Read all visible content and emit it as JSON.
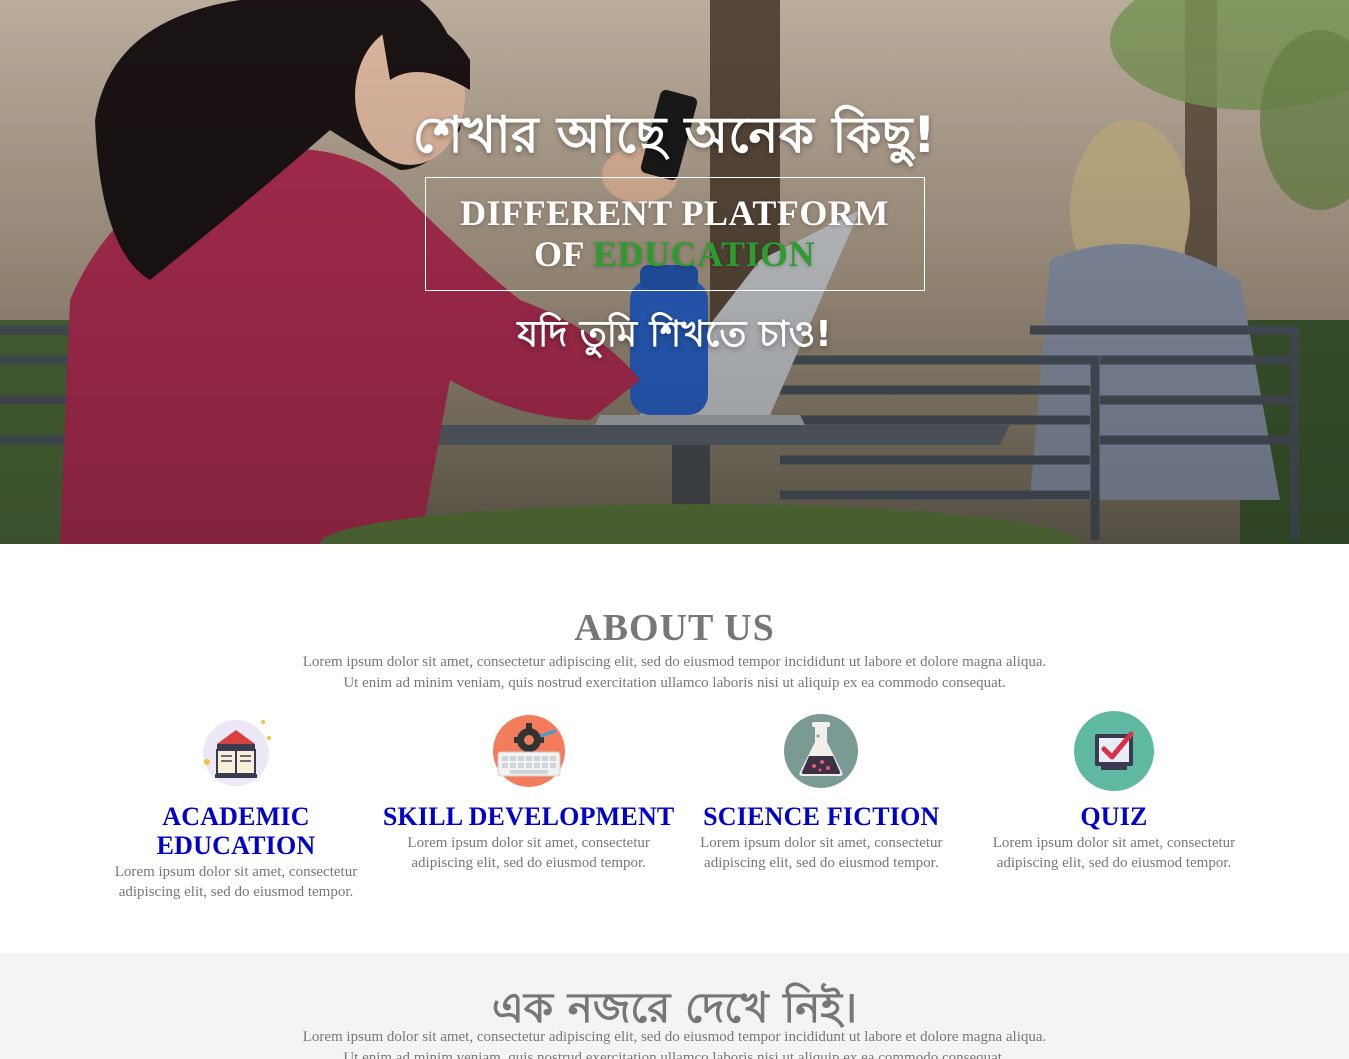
{
  "hero": {
    "title": "শেখার আছে অনেক কিছু!",
    "box_line1": "DIFFERENT PLATFORM",
    "box_line2_prefix": "OF ",
    "box_line2_accent": "EDUCATION",
    "subtitle": "যদি তুমি শিখতে চাও!",
    "accent_color": "#2e9b2e"
  },
  "about": {
    "title": "ABOUT US",
    "desc_line1": "Lorem ipsum dolor sit amet, consectetur adipiscing elit, sed do eiusmod tempor incididunt ut labore et dolore magna aliqua.",
    "desc_line2": "Ut enim ad minim veniam, quis nostrud exercitation ullamco laboris nisi ut aliquip ex ea commodo consequat.",
    "features": [
      {
        "icon": "book-icon",
        "title_line1": "ACADEMIC",
        "title_line2": "EDUCATION",
        "text_line1": "Lorem ipsum dolor sit amet, consectetur",
        "text_line2": "adipiscing elit, sed do eiusmod tempor."
      },
      {
        "icon": "keyboard-gear-icon",
        "title_line1": "SKILL DEVELOPMENT",
        "text_line1": "Lorem ipsum dolor sit amet, consectetur",
        "text_line2": "adipiscing elit, sed do eiusmod tempor."
      },
      {
        "icon": "flask-icon",
        "title_line1": "SCIENCE FICTION",
        "text_line1": "Lorem ipsum dolor sit amet, consectetur",
        "text_line2": "adipiscing elit, sed do eiusmod tempor."
      },
      {
        "icon": "checkbox-icon",
        "title_line1": "QUIZ",
        "text_line1": "Lorem ipsum dolor sit amet, consectetur",
        "text_line2": "adipiscing elit, sed do eiusmod tempor."
      }
    ],
    "title_color": "#0000cc"
  },
  "glance": {
    "title": "এক নজরে দেখে নিই।",
    "desc_line1": "Lorem ipsum dolor sit amet, consectetur adipiscing elit, sed do eiusmod tempor incididunt ut labore et dolore magna aliqua.",
    "desc_line2": "Ut enim ad minim veniam, quis nostrud exercitation ullamco laboris nisi ut aliquip ex ea commodo consequat."
  }
}
